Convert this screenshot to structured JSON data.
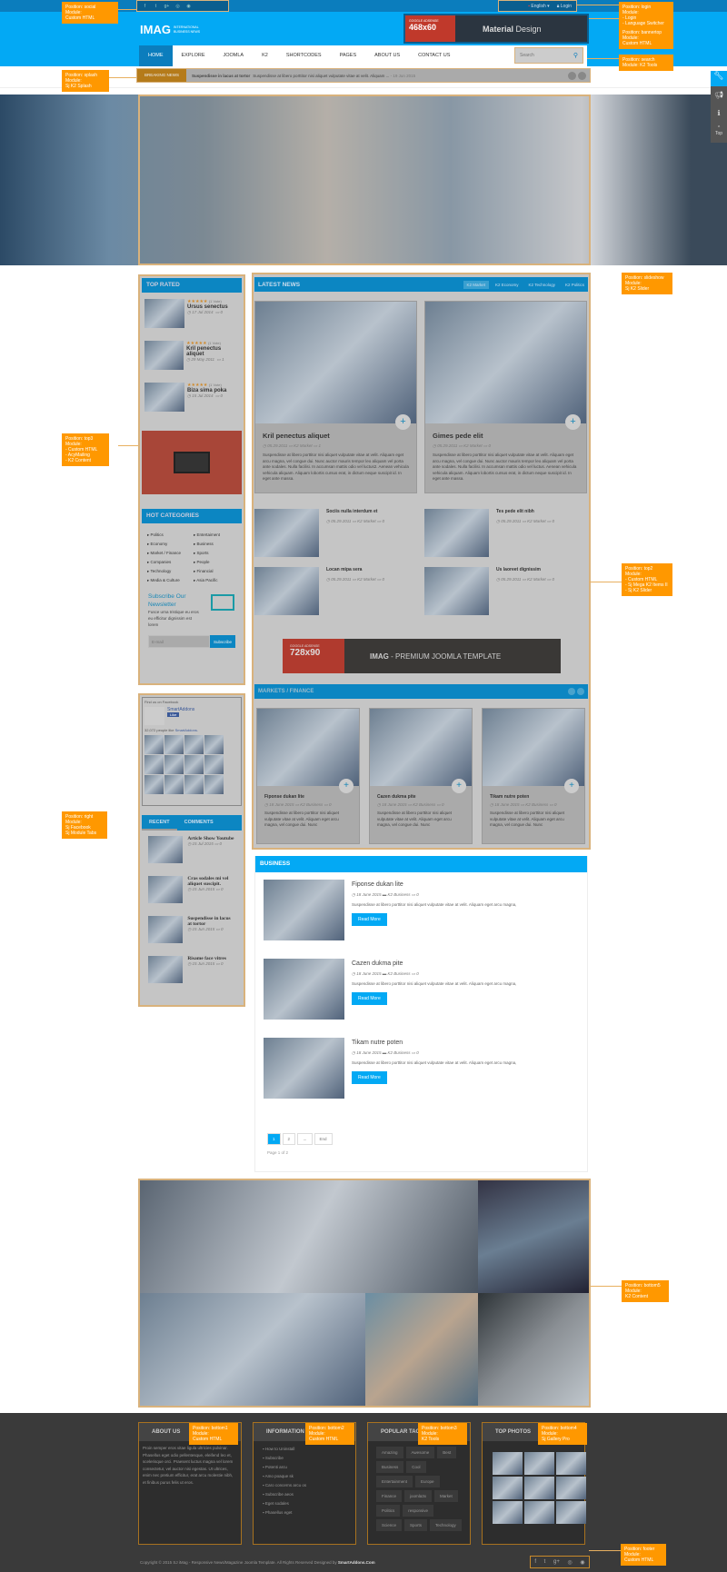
{
  "topbar": {
    "social_icons": [
      "facebook-icon",
      "twitter-icon",
      "google-plus-icon",
      "dribbble-icon",
      "rss-icon"
    ],
    "language": "English",
    "login": "Login"
  },
  "logo": {
    "name": "IMAG",
    "tagline_1": "INTERNATIONAL",
    "tagline_2": "BUSINESS NEWS"
  },
  "banner_top": {
    "label": "GOOGLE ADSENSE",
    "size": "468x60",
    "title_bold": "Material",
    "title_light": " Design"
  },
  "nav": {
    "items": [
      "HOME",
      "EXPLORE",
      "JOOMLA",
      "K2",
      "SHORTCODES",
      "PAGES",
      "ABOUT US",
      "CONTACT US"
    ],
    "active": 0,
    "search_placeholder": "Search"
  },
  "breaking": {
    "label": "BREAKING NEWS",
    "title": "Suspendisse in lacus at tortor",
    "text": "Suspendisse at libero porttitor nisi aliquet vulputate vitae at velit. Aliquam ...",
    "date": "- 19 Jun 2015"
  },
  "side_tools": [
    "wrench-icon",
    "megaphone-icon",
    "info-icon"
  ],
  "side_top": "Top",
  "positions": {
    "social": "Position: social\nModule:\nCustom HTML",
    "login": "Position: login\nModule:\n- Login\n- Language Switcher",
    "bannertop": "Position: bannertop\nModule:\nCustom HTML",
    "search": "Position: search\nModule: K2 Tools",
    "splash": "Position: splash\nModule:\nSj K2 Splash",
    "slideshow": "Position: slideshow\nModule:\nSj K2 Slider",
    "top3": "Position: top3\nModule:\n- Custom HTML\n- AcyMailing\n- K2 Content",
    "top2": "Position: top2\nModule:\n- Custom HTML\n- Sj Mega K2 Items II\n- Sj K2 Slider",
    "right": "Position: right\nModule:\nSj Facebook\nSj Module Tabs",
    "bottom5": "Position: bottom5\nModule:\nK2 Content",
    "bottom1": "Position: bottom1\nModule:\nCustom HTML",
    "bottom2": "Position: bottom2\nModule:\nCustom HTML",
    "bottom3": "Position: bottom3\nModule:\nK2 Tools",
    "bottom4": "Position: bottom4\nModule:\nSj Gallery Pro",
    "footer": "Position: footer\nModule:\nCustom HTML"
  },
  "top_rated": {
    "title": "TOP RATED",
    "items": [
      {
        "title": "Ursus senectus",
        "votes": "(1 Vote)",
        "date": "17 Jul 2014",
        "comments": "0",
        "rating": 5
      },
      {
        "title": "Kril penectus aliquet",
        "votes": "(1 Vote)",
        "date": "29 May 2011",
        "comments": "1",
        "rating": 5
      },
      {
        "title": "Biza sima poka",
        "votes": "(1 Vote)",
        "date": "15 Jul 2014",
        "comments": "0",
        "rating": 5
      }
    ]
  },
  "hot_categories": {
    "title": "HOT CATEGORIES",
    "col1": [
      "Politics",
      "Economy",
      "Market / Finance",
      "Companies",
      "Technology",
      "Media & Culture"
    ],
    "col2": [
      "Entertaiment",
      "Business",
      "Sports",
      "People",
      "Financial",
      "Asia Pacific"
    ]
  },
  "newsletter": {
    "title": "Subscribe Our Newsletter",
    "text": "Fusce urna tristique eu eros eu efficitur dignissim est lorem",
    "placeholder": "E-mail",
    "button": "Subscribe"
  },
  "facebook": {
    "header": "Find us on Facebook",
    "page": "SmartAddons",
    "like": "Like",
    "count_text": "32,072 people like ",
    "count_link": "SmartAddons."
  },
  "tabs": {
    "labels": [
      "RECENT",
      "COMMENTS"
    ],
    "items": [
      {
        "title": "Article Show Youtube",
        "date": "15 Jul 2015",
        "comments": "0"
      },
      {
        "title": "Cras sodales mi vel aliquet suscipit.",
        "date": "15 Jun 2015",
        "comments": "0"
      },
      {
        "title": "Suspendisse in lacus at tortor",
        "date": "15 Jun 2015",
        "comments": "0"
      },
      {
        "title": "Risame face vitres",
        "date": "15 Jun 2015",
        "comments": "0"
      }
    ]
  },
  "latest": {
    "title": "LATEST NEWS",
    "tabs": [
      "K2 Market",
      "K2 Economy",
      "K2 Technology",
      "K2 Politics"
    ],
    "featured": [
      {
        "title": "Kril penectus aliquet",
        "date": "05.29.2011",
        "category": "K2 Market",
        "comments": "1",
        "text": "Suspendisse at libero porttitor nisi aliquet vulputate vitae at velit. Aliquam eget arcu magna, vel congue dui. Nunc auctor mauris tempor leo aliquam vel porta ante sodales. Nulla facilisi. In accumsan mattis odio vel luctus2. Aenean vehicula vehicula aliquam. Aliquam lobortis cursus erat, in dictum neque suscipit id. In eget ante massa."
      },
      {
        "title": "Gimes pede elit",
        "date": "05.29.2011",
        "category": "K2 Market",
        "comments": "0",
        "text": "Suspendisse at libero porttitor nisi aliquet vulputate vitae at velit. Aliquam eget arcu magna, vel congue dui. Nunc auctor mauris tempor leo aliquam vel porta ante sodales. Nulla facilisi. In accumsan mattis odio vel luctus. Aenean vehicula vehicula aliquam. Aliquam lobortis cursus erat, in dictum neque suscipit id. In eget ante massa."
      }
    ],
    "small": [
      {
        "title": "Sociis nulla interdum et",
        "date": "05.29.2011",
        "category": "K2 Market",
        "comments": "0"
      },
      {
        "title": "Tes pede elit nibh",
        "date": "05.29.2011",
        "category": "K2 Market",
        "comments": "0"
      },
      {
        "title": "Locan mipa sera",
        "date": "05.29.2011",
        "category": "K2 Market",
        "comments": "0"
      },
      {
        "title": "Us laoreet dignissim",
        "date": "05.29.2011",
        "category": "K2 Market",
        "comments": "0"
      }
    ]
  },
  "ad728": {
    "label": "GOOGLE ADSENSE",
    "size": "728x90",
    "brand": "IMAG",
    "text": " - PREMIUM JOOMLA TEMPLATE"
  },
  "markets": {
    "title": "MARKETS / FINANCE",
    "items": [
      {
        "title": "Fiponse dukan lite",
        "date": "18 June 2015",
        "category": "K2 Business",
        "comments": "0",
        "text": "Suspendisse at libero porttitor nisi aliquet vulputate vitae at velit. Aliquam eget arcu magna, vel congue dui. Nunc"
      },
      {
        "title": "Cazen dukma pite",
        "date": "18 June 2015",
        "category": "K2 Business",
        "comments": "0",
        "text": "Suspendisse at libero porttitor nisi aliquet vulputate vitae at velit. Aliquam eget arcu magna, vel congue dui. Nunc"
      },
      {
        "title": "Tikam nutre poten",
        "date": "18 June 2015",
        "category": "K2 Business",
        "comments": "0",
        "text": "Suspendisse at libero porttitor nisi aliquet vulputate vitae at velit. Aliquam eget arcu magna, vel congue dui. Nunc"
      }
    ]
  },
  "business": {
    "title": "BUSINESS",
    "read_more": "Read More",
    "items": [
      {
        "title": "Fiponse dukan lite",
        "date": "18 June 2015",
        "category": "K2 Business",
        "comments": "0",
        "text": "Suspendisse at libero porttitor nisi aliquet vulputate vitae at velit. Aliquam eget arcu magna,"
      },
      {
        "title": "Cazen dukma pite",
        "date": "18 June 2015",
        "category": "K2 Business",
        "comments": "0",
        "text": "Suspendisse at libero porttitor nisi aliquet vulputate vitae at velit. Aliquam eget arcu magna,"
      },
      {
        "title": "Tikam nutre poten",
        "date": "18 June 2015",
        "category": "K2 Business",
        "comments": "0",
        "text": "Suspendisse at libero porttitor nisi aliquet vulputate vitae at velit. Aliquam eget arcu magna,"
      }
    ],
    "pagination": [
      "1",
      "2",
      "→",
      "End"
    ],
    "page_info": "Page 1 of 2"
  },
  "footer": {
    "about": {
      "title": "ABOUT US",
      "text": "Proin semper eros vitae ligula ultricies pulvinar. Phasellus eget odio pellentesque, eleifend leo et, scelerisque orci. Praesent luctus magna vel lorem consectetur, vel auctor nisi egestas. Ut ultrices, enim nec pretium efficitur, erat arcu molestie nibh, et finibus purus felis ut eros."
    },
    "info": {
      "title": "INFORMATION",
      "items": [
        "How to Uninstall",
        "Subscribe",
        "Potenti arcu",
        "Amo poaque sk",
        "Caro concerns arcu os",
        "Subscribe aeos",
        "Eget sodales",
        "Phasellus eget"
      ]
    },
    "tags": {
      "title": "POPULAR TAGS",
      "items": [
        "Amazing",
        "Awesome",
        "Best",
        "Business",
        "Cool",
        "Entertainment",
        "Europe",
        "Finance",
        "joomla3x",
        "Market",
        "Politics",
        "responsive",
        "Science",
        "Sports",
        "Technology"
      ]
    },
    "photos": {
      "title": "TOP PHOTOS"
    },
    "copyright": "Copyright © 2015 SJ iMag - Responsive News/Magazine Joomla Template. All Rights Reserved Designed by ",
    "designer": "SmartAddons.Com",
    "social_icons": [
      "facebook-icon",
      "twitter-icon",
      "google-plus-icon",
      "dribbble-icon",
      "rss-icon"
    ]
  },
  "colors": {
    "brand": "#03a9f4",
    "topbar": "#0b7dbd",
    "module_header": "#0c86c2",
    "label": "#ff9800",
    "footer": "#3a3a3a"
  }
}
